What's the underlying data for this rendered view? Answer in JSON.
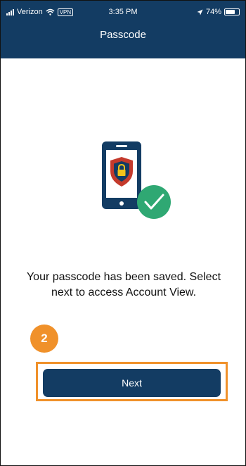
{
  "status_bar": {
    "carrier": "Verizon",
    "vpn": "VPN",
    "time": "3:35 PM",
    "battery": "74%",
    "battery_level": 0.74
  },
  "header": {
    "title": "Passcode"
  },
  "main": {
    "message": "Your passcode has been saved. Select next to access Account View."
  },
  "step_badge": "2",
  "buttons": {
    "next_label": "Next"
  },
  "colors": {
    "brand": "#133c63",
    "highlight": "#f0912a",
    "success": "#2fa873",
    "shield_red": "#c43a2c",
    "lock_yellow": "#f2c21b"
  }
}
